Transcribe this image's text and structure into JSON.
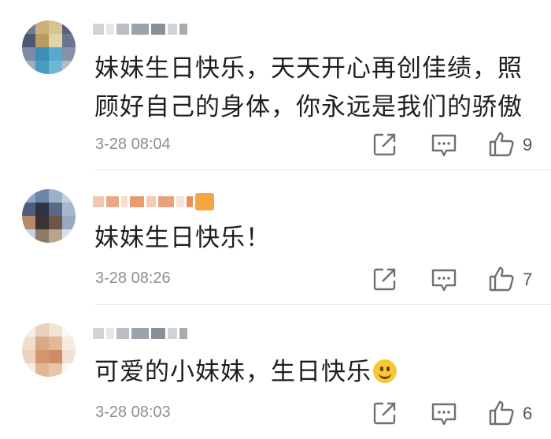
{
  "comments": [
    {
      "text": "妹妹生日快乐，天天开心再创佳绩，照顾好自己的身体，你永远是我们的骄傲",
      "timestamp": "3-28 08:04",
      "likes": "9",
      "icons": [
        "share-icon",
        "comment-icon",
        "like-icon"
      ]
    },
    {
      "text": "妹妹生日快乐！",
      "timestamp": "3-28 08:26",
      "likes": "7",
      "icons": [
        "share-icon",
        "comment-icon",
        "like-icon"
      ]
    },
    {
      "text": "可爱的小妹妹，生日快乐",
      "timestamp": "3-28 08:03",
      "likes": "6",
      "icons": [
        "share-icon",
        "comment-icon",
        "like-icon",
        "smile-emoji"
      ]
    }
  ],
  "colors": {
    "text": "#1e1e1e",
    "meta": "#8e8e8e",
    "icon": "#707070",
    "divider": "#e8e8e8"
  }
}
